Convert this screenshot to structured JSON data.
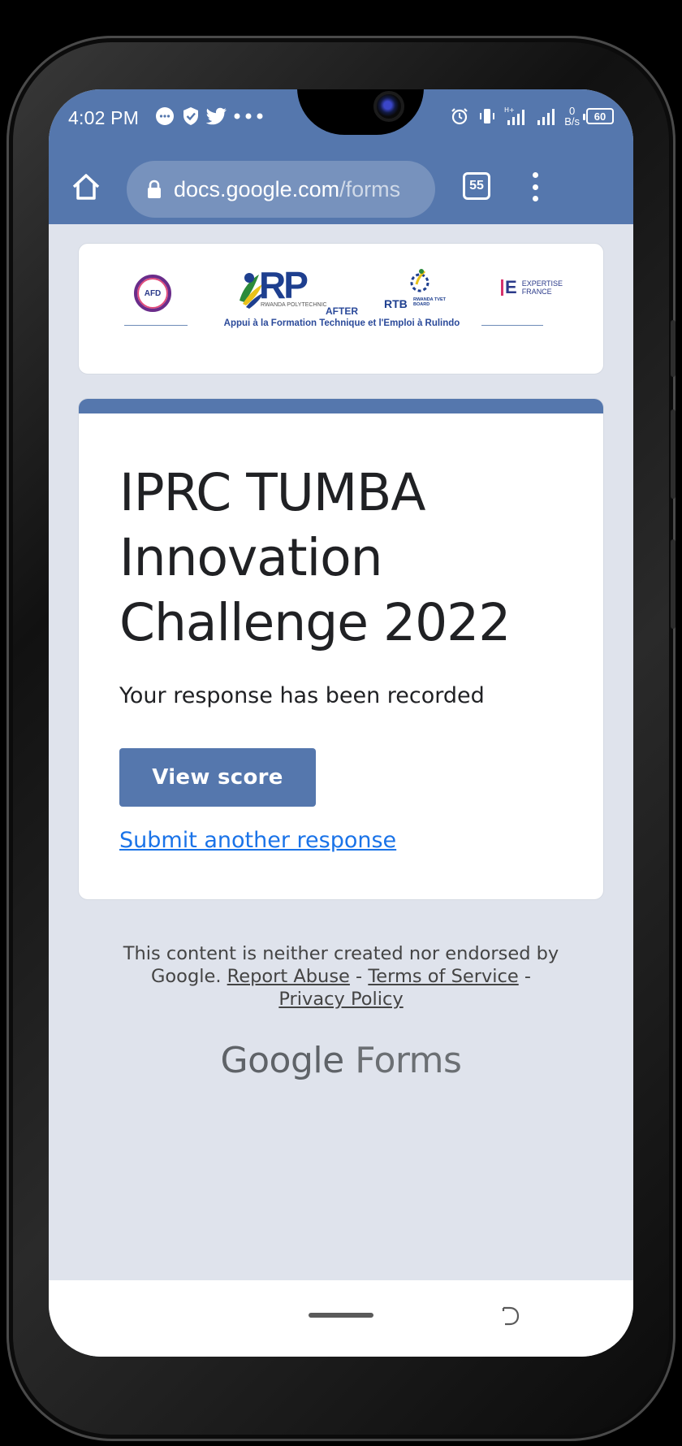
{
  "status_bar": {
    "time": "4:02 PM",
    "left_icons": [
      "chat-icon",
      "shield-icon",
      "twitter-icon",
      "more-dots-icon"
    ],
    "right_icons": [
      "alarm-icon",
      "vibrate-icon",
      "hplus-signal-icon",
      "signal-icon"
    ],
    "network_speed_value": "0",
    "network_speed_unit": "B/s",
    "battery": "60"
  },
  "browser": {
    "url_domain": "docs.google.com",
    "url_path": "/forms",
    "tab_count": "55"
  },
  "banner": {
    "afd_label": "AFD",
    "rp_label": "RP",
    "rp_sub": "RWANDA POLYTECHNIC",
    "rtb_label": "RTB",
    "rtb_sub": "RWANDA TVET BOARD",
    "ef_mark": "E",
    "ef_text": "EXPERTISE FRANCE",
    "after_title": "AFTER",
    "after_subtitle": "Appui à la Formation Technique et l'Emploi à Rulindo"
  },
  "form": {
    "title": "IPRC TUMBA Innovation Challenge 2022",
    "confirmation": "Your response has been recorded",
    "view_score_label": "View score",
    "submit_another_label": "Submit another response"
  },
  "footer": {
    "disclaimer": "This content is neither created nor endorsed by Google.",
    "report_abuse": "Report Abuse",
    "separator": "-",
    "terms": "Terms of Service",
    "privacy": "Privacy Policy",
    "brand_google": "Google",
    "brand_forms": "Forms"
  },
  "colors": {
    "theme": "#5577ad",
    "background": "#dfe3ec",
    "link": "#1a73e8"
  }
}
